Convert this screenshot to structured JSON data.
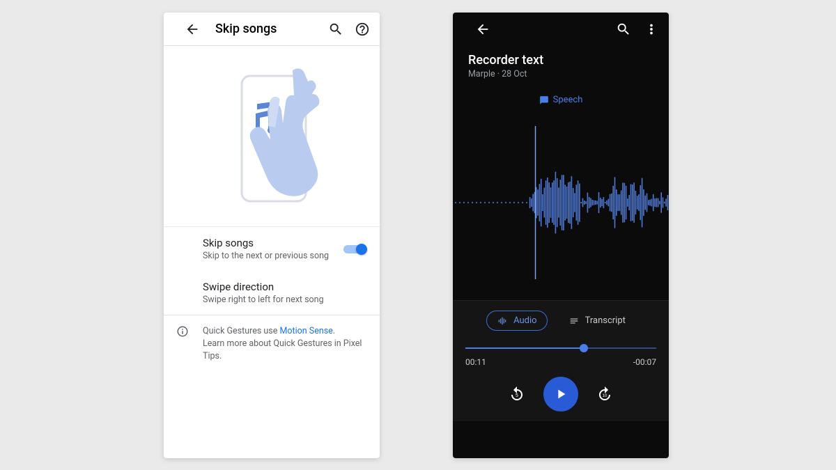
{
  "left": {
    "appbar_title": "Skip songs",
    "setting1": {
      "title": "Skip songs",
      "sub": "Skip to the next or previous song"
    },
    "setting2": {
      "title": "Swipe direction",
      "sub": "Swipe right to left for next song"
    },
    "info_prefix": "Quick Gestures use ",
    "info_link": "Motion Sense",
    "info_suffix": ".",
    "info_line2": "Learn more about Quick Gestures in Pixel Tips."
  },
  "right": {
    "title": "Recorder text",
    "subtitle": "Marple · 28 Oct",
    "chip": "Speech",
    "tab_audio": "Audio",
    "tab_transcript": "Transcript",
    "time_elapsed": "00:11",
    "time_remaining": "-00:07"
  }
}
